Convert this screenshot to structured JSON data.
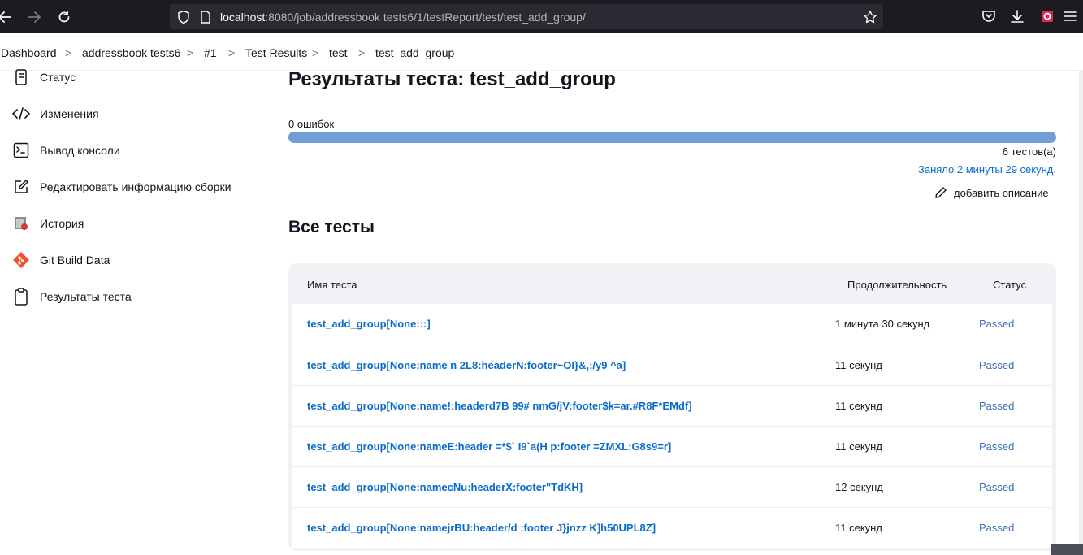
{
  "browser": {
    "url_host": "localhost",
    "url_rest": ":8080/job/addressbook tests6/1/testReport/test/test_add_group/"
  },
  "breadcrumb": {
    "items": [
      "Dashboard",
      "addressbook tests6",
      "#1",
      "Test Results",
      "test",
      "test_add_group"
    ],
    "separator": ">"
  },
  "sidebar": {
    "items": [
      {
        "label": "Статус",
        "icon": "document-icon"
      },
      {
        "label": "Изменения",
        "icon": "code-icon"
      },
      {
        "label": "Вывод консоли",
        "icon": "terminal-icon"
      },
      {
        "label": "Редактировать информацию сборки",
        "icon": "edit-icon"
      },
      {
        "label": "История",
        "icon": "history-icon"
      },
      {
        "label": "Git Build Data",
        "icon": "git-icon"
      },
      {
        "label": "Результаты теста",
        "icon": "clipboard-icon"
      }
    ]
  },
  "main": {
    "title": "Результаты теста: test_add_group",
    "failures": "0 ошибок",
    "progress_pass_fraction": 1.0,
    "tests_count": "6 тестов(а)",
    "duration": "Заняло 2 минуты 29 секунд.",
    "add_description": "добавить описание",
    "section_title": "Все тесты"
  },
  "table": {
    "headers": {
      "name": "Имя теста",
      "duration": "Продолжительность",
      "status": "Статус"
    },
    "rows": [
      {
        "name": "test_add_group[None:::]",
        "duration": "1 минута 30 секунд",
        "status": "Passed"
      },
      {
        "name": "test_add_group[None:name n 2L8:headerN:footer~OI}&,;/y9 ^a]",
        "duration": "11 секунд",
        "status": "Passed"
      },
      {
        "name": "test_add_group[None:name!:headerd7B 99# nmG/jV:footer$k=ar.#R8F*EMdf]",
        "duration": "11 секунд",
        "status": "Passed"
      },
      {
        "name": "test_add_group[None:nameE:header =*$` I9`a(H p:footer =ZMXL:G8s9=r]",
        "duration": "11 секунд",
        "status": "Passed"
      },
      {
        "name": "test_add_group[None:namecNu:headerX:footer\"TdKH]",
        "duration": "12 секунд",
        "status": "Passed"
      },
      {
        "name": "test_add_group[None:namejrBU:header/d :footer J}jnzz K]h50UPL8Z]",
        "duration": "11 секунд",
        "status": "Passed"
      }
    ]
  },
  "colors": {
    "link": "#0b6bcb",
    "progress": "#6f9fd4",
    "browser_bar": "#1c1b22"
  }
}
